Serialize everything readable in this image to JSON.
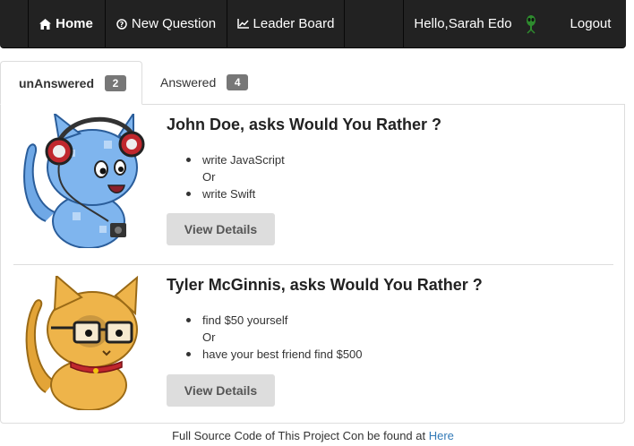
{
  "nav": {
    "home_label": "Home",
    "new_question_label": "New Question",
    "leader_board_label": "Leader Board",
    "greeting": "Hello,Sarah Edo",
    "logout_label": "Logout",
    "icons": {
      "home": "home-icon",
      "new_question": "question-circle-icon",
      "leader_board": "line-chart-icon",
      "user_avatar": "alien-avatar-icon"
    }
  },
  "tabs": [
    {
      "label": "unAnswered",
      "count": "2",
      "active": true
    },
    {
      "label": "Answered",
      "count": "4",
      "active": false
    }
  ],
  "questions": [
    {
      "author_line": "John Doe, asks Would You Rather ?",
      "option_one": "write JavaScript",
      "or_label": "Or",
      "option_two": "write Swift",
      "button_label": "View Details",
      "avatar": "blue-cat-with-headphones"
    },
    {
      "author_line": "Tyler McGinnis, asks Would You Rather ?",
      "option_one": "find $50 yourself",
      "or_label": "Or",
      "option_two": "have your best friend find $500",
      "button_label": "View Details",
      "avatar": "orange-cat-with-glasses"
    }
  ],
  "footer": {
    "text": "Full Source Code of This Project Con be found at",
    "link_label": "Here"
  },
  "colors": {
    "navbar": "#222222",
    "link": "#337ab7",
    "badge": "#777777",
    "button": "#dddddd"
  }
}
